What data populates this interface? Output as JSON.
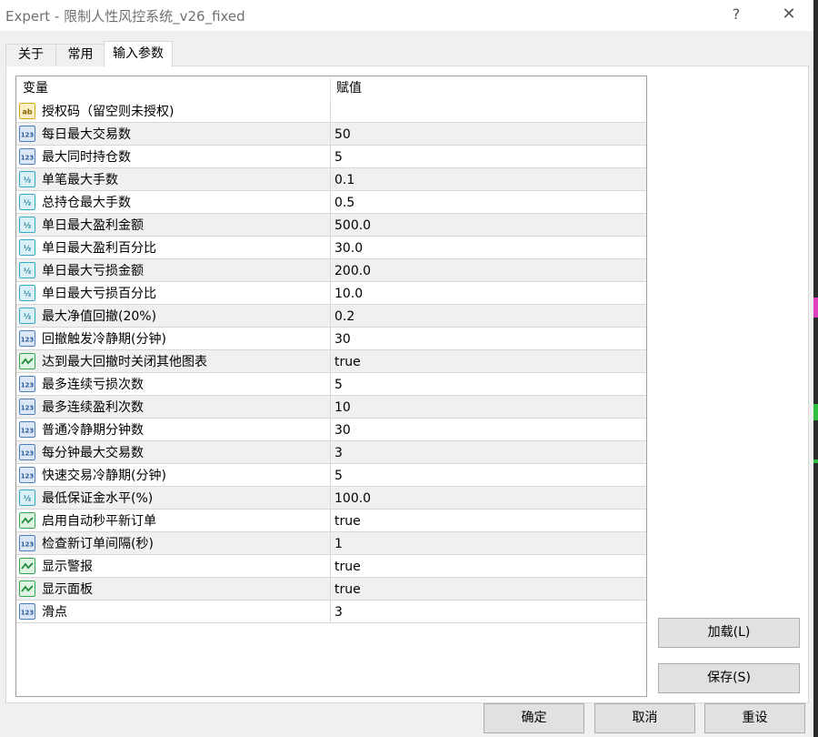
{
  "window": {
    "title": "Expert - 限制人性风控系统_v26_fixed",
    "help_glyph": "?",
    "close_glyph": "✕"
  },
  "tabs": [
    {
      "label": "关于"
    },
    {
      "label": "常用"
    },
    {
      "label": "输入参数",
      "active": true
    }
  ],
  "table": {
    "header_variable": "变量",
    "header_value": "赋值",
    "rows": [
      {
        "icon": "string-icon",
        "name": "授权码（留空则未授权)",
        "value": ""
      },
      {
        "icon": "integer-icon",
        "name": "每日最大交易数",
        "value": "50"
      },
      {
        "icon": "integer-icon",
        "name": "最大同时持仓数",
        "value": "5"
      },
      {
        "icon": "double-icon",
        "name": "单笔最大手数",
        "value": "0.1"
      },
      {
        "icon": "double-icon",
        "name": "总持仓最大手数",
        "value": "0.5"
      },
      {
        "icon": "double-icon",
        "name": "单日最大盈利金额",
        "value": "500.0"
      },
      {
        "icon": "double-icon",
        "name": "单日最大盈利百分比",
        "value": "30.0"
      },
      {
        "icon": "double-icon",
        "name": "单日最大亏损金额",
        "value": "200.0"
      },
      {
        "icon": "double-icon",
        "name": "单日最大亏损百分比",
        "value": "10.0"
      },
      {
        "icon": "double-icon",
        "name": "最大净值回撤(20%)",
        "value": "0.2"
      },
      {
        "icon": "integer-icon",
        "name": "回撤触发冷静期(分钟)",
        "value": "30"
      },
      {
        "icon": "boolean-icon",
        "name": "达到最大回撤时关闭其他图表",
        "value": "true"
      },
      {
        "icon": "integer-icon",
        "name": "最多连续亏损次数",
        "value": "5"
      },
      {
        "icon": "integer-icon",
        "name": "最多连续盈利次数",
        "value": "10"
      },
      {
        "icon": "integer-icon",
        "name": "普通冷静期分钟数",
        "value": "30"
      },
      {
        "icon": "integer-icon",
        "name": "每分钟最大交易数",
        "value": "3"
      },
      {
        "icon": "integer-icon",
        "name": "快速交易冷静期(分钟)",
        "value": "5"
      },
      {
        "icon": "double-icon",
        "name": "最低保证金水平(%)",
        "value": "100.0"
      },
      {
        "icon": "boolean-icon",
        "name": "启用自动秒平新订单",
        "value": "true"
      },
      {
        "icon": "integer-icon",
        "name": "检查新订单间隔(秒)",
        "value": "1"
      },
      {
        "icon": "boolean-icon",
        "name": "显示警报",
        "value": "true"
      },
      {
        "icon": "boolean-icon",
        "name": "显示面板",
        "value": "true"
      },
      {
        "icon": "integer-icon",
        "name": "滑点",
        "value": "3"
      }
    ]
  },
  "side_buttons": {
    "load": "加载(L)",
    "save": "保存(S)"
  },
  "footer_buttons": {
    "ok": "确定",
    "cancel": "取消",
    "reset": "重设"
  },
  "colors": {
    "icon_integer": "#4a7fc0",
    "icon_double": "#34a8c8",
    "icon_boolean": "#2fa84f",
    "icon_string": "#d9a520"
  }
}
